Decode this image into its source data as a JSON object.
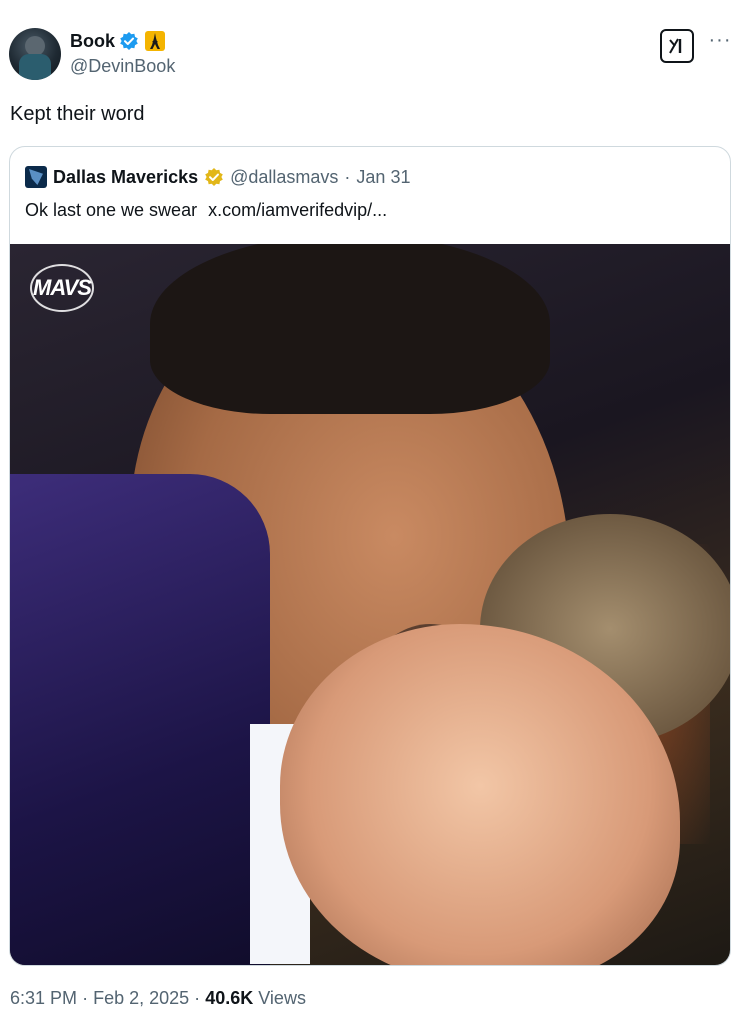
{
  "author": {
    "name": "Book",
    "handle": "@DevinBook",
    "avatar_icon": "avatar-photo",
    "verified_color": "#1d9bf0",
    "affiliation_icon": "eiffel-tower-badge-icon"
  },
  "tweet": {
    "text": "Kept their word"
  },
  "quote": {
    "name": "Dallas Mavericks",
    "handle": "@dallasmavs",
    "separator": "·",
    "date": "Jan 31",
    "text": "Ok last one we swear",
    "link": "x.com/iamverifedvip/...",
    "verified_color": "#e2b719",
    "media_logo": "MAVS"
  },
  "footer": {
    "time": "6:31 PM",
    "separator1": "·",
    "date": "Feb 2, 2025",
    "separator2": "·",
    "views_count": "40.6K",
    "views_label": "Views"
  },
  "icons": {
    "grok": "grok-icon",
    "more": "more-options-icon"
  }
}
